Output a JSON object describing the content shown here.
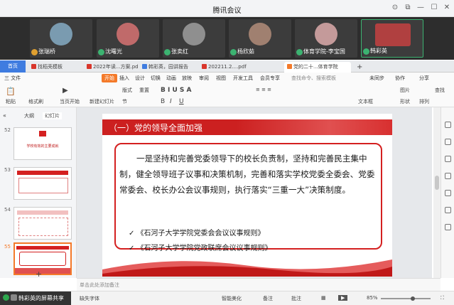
{
  "window": {
    "title": "腾讯会议"
  },
  "participants": [
    {
      "name": "张瑞桥",
      "color": "#7a9bb0"
    },
    {
      "name": "沈曙光",
      "color": "#c06a6a"
    },
    {
      "name": "张卖红",
      "color": "#8f8f8f"
    },
    {
      "name": "杨欣茹",
      "color": "#a08070"
    },
    {
      "name": "体育学院-李宝国",
      "color": "#c49a9a"
    },
    {
      "name": "韩彩英",
      "color": "#b04040"
    }
  ],
  "tabs": [
    {
      "label": "首页",
      "kind": "home"
    },
    {
      "label": "找稻壳模板",
      "color": "#d9362b"
    },
    {
      "label": "2022年读...方案.pdf",
      "color": "#d9362b"
    },
    {
      "label": "韩彩英，园讲报告",
      "color": "#3f7ce0"
    },
    {
      "label": "202211.2....pdf",
      "color": "#d9362b"
    },
    {
      "label": "党的二十...体育学院",
      "color": "#f47a2a",
      "active": true
    }
  ],
  "menu": [
    "三 文件",
    "开始",
    "插入",
    "设计",
    "切换",
    "动画",
    "放映",
    "审阅",
    "视图",
    "开发工具",
    "会员专享",
    "查找命令、搜索模板"
  ],
  "menu_right": [
    "未同步",
    "协作",
    "分享"
  ],
  "toolbar": [
    "粘贴",
    "格式刷",
    "当页开始",
    "新建幻灯片",
    "版式",
    "节",
    "重置",
    "文本框",
    "图片",
    "形状",
    "排列",
    "查找"
  ],
  "left_panel": {
    "tabs": [
      "大纲",
      "幻灯片"
    ],
    "slide_numbers": [
      "52",
      "53",
      "54",
      "55"
    ],
    "thumb_texts": [
      "学校有效的主要成就",
      "",
      "",
      ""
    ]
  },
  "slide": {
    "heading": "（一）党的领导全面加强",
    "paragraph": "一是坚持和完善党委领导下的校长负责制，坚持和完善民主集中制，健全领导班子议事和决策机制，完善和落实学校党委全委会、党委常委会、校长办公会议事规则，执行落实“三重一大”决策制度。",
    "checks": [
      "✓ 《石河子大学学院党委会会议议事规则》",
      "✓ 《石河子大学学院党政联席会议议事规则》"
    ]
  },
  "notes_placeholder": "单击此处添加备注",
  "status": {
    "missing_fonts": "缺失字体",
    "smart_beautify": "智能美化",
    "notes": "备注",
    "comments": "批注",
    "zoom": "85%"
  },
  "share_banner": "韩彩英的屏幕共享"
}
